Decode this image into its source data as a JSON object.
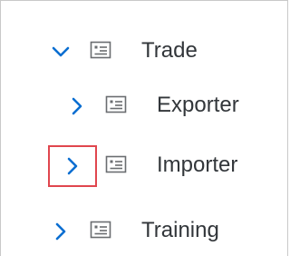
{
  "tree": {
    "items": [
      {
        "label": "Trade",
        "expanded": true,
        "level": 1,
        "toggle_icon": "chevron-down-icon",
        "node_icon": "folder-icon"
      },
      {
        "label": "Exporter",
        "expanded": false,
        "level": 2,
        "toggle_icon": "chevron-right-icon",
        "node_icon": "folder-icon"
      },
      {
        "label": "Importer",
        "expanded": false,
        "level": 2,
        "toggle_icon": "chevron-right-icon",
        "node_icon": "folder-icon",
        "highlighted": true
      },
      {
        "label": "Training",
        "expanded": false,
        "level": 1,
        "toggle_icon": "chevron-right-icon",
        "node_icon": "folder-icon"
      }
    ]
  },
  "colors": {
    "icon": "#0a6ed1",
    "text": "#32363a",
    "highlight": "#e0464e",
    "border": "#c9c9c9"
  }
}
